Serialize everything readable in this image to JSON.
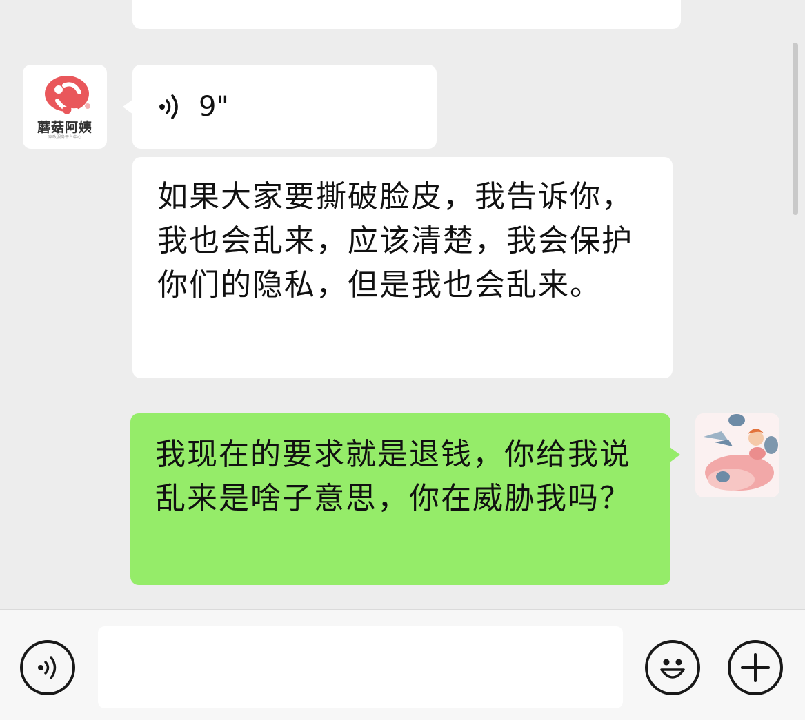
{
  "chat": {
    "messages": [
      {
        "sender": "other",
        "type": "voice",
        "duration": "9\""
      },
      {
        "sender": "other",
        "type": "text",
        "text": "如果大家要撕破脸皮，我告诉你，我也会乱来，应该清楚，我会保护你们的隐私，但是我也会乱来。"
      },
      {
        "sender": "me",
        "type": "text",
        "text": "我现在的要求就是退钱，你给我说乱来是啥子意思，你在威胁我吗？"
      }
    ],
    "other_avatar": {
      "brand": "蘑菇阿姨",
      "tagline": "家政服务平台中心",
      "accent": "#e9575b"
    },
    "colors": {
      "background": "#ededed",
      "my_bubble": "#95ec69",
      "other_bubble": "#ffffff"
    }
  },
  "input_bar": {
    "voice_button_icon": "voice-icon",
    "input_value": "",
    "emoji_button_icon": "emoji-icon",
    "more_button_icon": "plus-icon"
  }
}
